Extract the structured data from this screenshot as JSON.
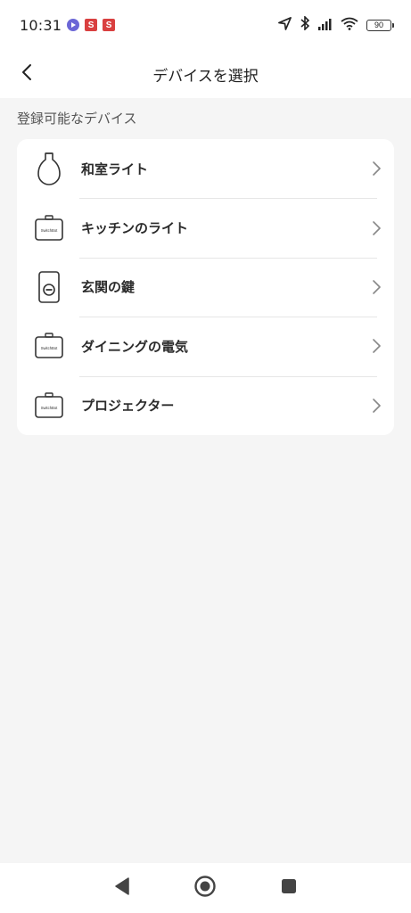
{
  "status_bar": {
    "time": "10:31",
    "battery": "90",
    "notif_badge_1": "S",
    "notif_badge_2": "S",
    "icons": [
      "play-notif-icon",
      "s-notif-icon",
      "s-notif-icon",
      "location-icon",
      "bluetooth-icon",
      "signal-icon",
      "wifi-icon",
      "battery-icon"
    ]
  },
  "header": {
    "title": "デバイスを選択",
    "back_icon": "chevron-left-icon"
  },
  "section": {
    "label": "登録可能なデバイス"
  },
  "devices": [
    {
      "label": "和室ライト",
      "icon": "light-bulb-icon"
    },
    {
      "label": "キッチンのライト",
      "icon": "switchbot-hub-icon",
      "icon_text": "SwitchBot"
    },
    {
      "label": "玄関の鍵",
      "icon": "smart-lock-icon"
    },
    {
      "label": "ダイニングの電気",
      "icon": "switchbot-hub-icon",
      "icon_text": "SwitchBot"
    },
    {
      "label": "プロジェクター",
      "icon": "switchbot-hub-icon",
      "icon_text": "SwitchBot"
    }
  ],
  "nav_bar": {
    "icons": [
      "back-triangle-icon",
      "home-circle-icon",
      "recents-square-icon"
    ]
  }
}
